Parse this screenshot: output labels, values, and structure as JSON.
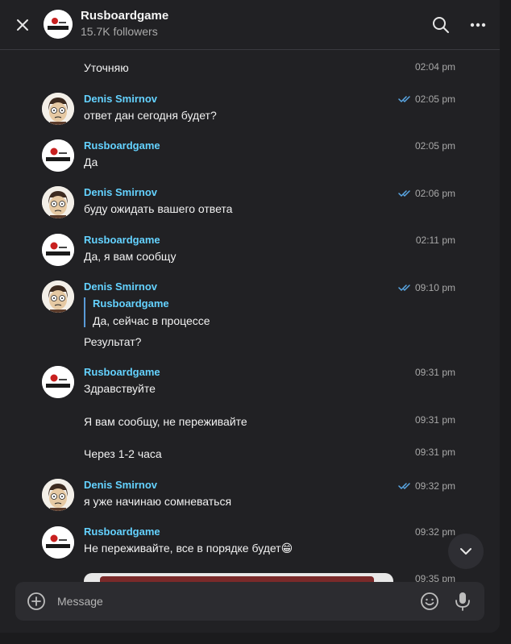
{
  "header": {
    "title": "Rusboardgame",
    "followers": "15.7K followers",
    "avatar_text": "RUSboardGAME"
  },
  "composer": {
    "placeholder": "Message"
  },
  "messages": [
    {
      "sender": "",
      "text": "Уточняю",
      "time": "02:04 pm",
      "read": false
    },
    {
      "sender": "Denis Smirnov",
      "text": "ответ дан сегодня будет?",
      "time": "02:05 pm",
      "read": true
    },
    {
      "sender": "Rusboardgame",
      "text": "Да",
      "time": "02:05 pm",
      "read": false
    },
    {
      "sender": "Denis Smirnov",
      "text": "буду ожидать вашего ответа",
      "time": "02:06 pm",
      "read": true
    },
    {
      "sender": "Rusboardgame",
      "text": "Да, я вам сообщу",
      "time": "02:11 pm",
      "read": false
    },
    {
      "sender": "Denis Smirnov",
      "reply_to": {
        "name": "Rusboardgame",
        "text": "Да, сейчас в процессе"
      },
      "text": "Результат?",
      "time": "09:10 pm",
      "read": true
    },
    {
      "sender": "Rusboardgame",
      "text": "Здравствуйте",
      "time": "09:31 pm",
      "read": false
    },
    {
      "sender": "",
      "text": "Я вам сообщу, не переживайте",
      "time": "09:31 pm",
      "read": false
    },
    {
      "sender": "",
      "text": "Через 1-2 часа",
      "time": "09:31 pm",
      "read": false
    },
    {
      "sender": "Denis Smirnov",
      "text": "я уже начинаю сомневаться",
      "time": "09:32 pm",
      "read": true
    },
    {
      "sender": "Rusboardgame",
      "text": "Не переживайте, все в порядке будет😁",
      "time": "09:32 pm",
      "read": false
    },
    {
      "sender": "",
      "text": "",
      "time": "09:35 pm",
      "read": false
    }
  ],
  "colors": {
    "background": "#212124",
    "name_accent": "#64d2ff",
    "read_check": "#5aa8e6",
    "time": "#a8a8a8"
  },
  "icons": [
    "close-icon",
    "search-icon",
    "more-icon",
    "add-icon",
    "emoji-icon",
    "microphone-icon",
    "chevron-down-icon",
    "double-check-icon"
  ]
}
